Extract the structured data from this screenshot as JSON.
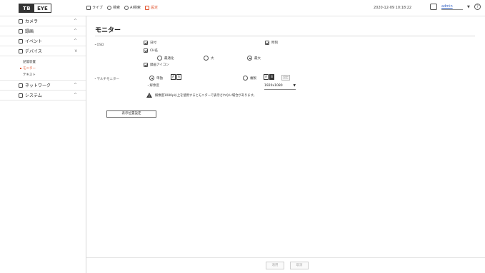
{
  "header": {
    "logo_left": "TB",
    "logo_right": "EYE",
    "nav": [
      {
        "label": "ライブ",
        "icon": "monitor-icon"
      },
      {
        "label": "検索",
        "icon": "search-icon"
      },
      {
        "label": "AI検索",
        "icon": "ai-search-icon"
      },
      {
        "label": "設定",
        "icon": "setup-icon"
      }
    ],
    "datetime": "2020-12-09 10:18:22",
    "user": "admin",
    "user_arrow": "▼",
    "help": "?"
  },
  "sidebar": {
    "groups": [
      {
        "label": "カメラ",
        "icon": "camera-icon",
        "chevron": "^"
      },
      {
        "label": "録画",
        "icon": "record-icon",
        "chevron": "^"
      },
      {
        "label": "イベント",
        "icon": "event-icon",
        "chevron": "^"
      },
      {
        "label": "デバイス",
        "icon": "device-icon",
        "chevron": "v"
      }
    ],
    "device_sub": [
      {
        "label": "記憶装置",
        "active": false
      },
      {
        "label": "モニター",
        "active": true
      },
      {
        "label": "テキスト",
        "active": false
      }
    ],
    "groups_after": [
      {
        "label": "ネットワーク",
        "icon": "network-icon",
        "chevron": "^"
      },
      {
        "label": "システム",
        "icon": "system-icon",
        "chevron": "^"
      }
    ]
  },
  "main": {
    "title": "モニター",
    "osd_label": "・OSD",
    "osd_checks": [
      {
        "label": "日付",
        "checked": true
      },
      {
        "label": "CH名",
        "checked": true
      },
      {
        "label": "録画アイコン",
        "checked": true
      },
      {
        "label": "時刻",
        "checked": true
      }
    ],
    "chname_options": [
      {
        "label": "最適化",
        "selected": false
      },
      {
        "label": "大",
        "selected": false
      },
      {
        "label": "最大",
        "selected": true
      }
    ],
    "multi_label": "・マルチモニター",
    "multi_options": [
      {
        "label": "単独",
        "selected": true
      },
      {
        "label": "複製",
        "selected": false
      }
    ],
    "single_icon": [
      "A",
      "A"
    ],
    "dual_icon": [
      "A",
      "B"
    ],
    "setting_button": "設定",
    "resolution_label": "・解像度",
    "resolution_value": "1920x1080",
    "resolution_arrow": "▼",
    "warning_text": "解像度1080p以上を使用するとモニターで表示されない場合があります。",
    "display_setting_button": "表示位置設定",
    "apply_button": "適用",
    "cancel_button": "取消"
  }
}
